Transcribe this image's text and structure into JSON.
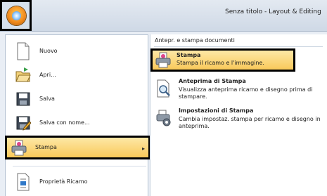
{
  "window": {
    "title": "Senza titolo - Layout & Editing"
  },
  "app_menu": {
    "items": [
      {
        "label": "Nuovo",
        "icon": "new-document-icon"
      },
      {
        "label": "Apri...",
        "icon": "open-folder-icon"
      },
      {
        "label": "Salva",
        "icon": "save-icon"
      },
      {
        "label": "Salva con nome...",
        "icon": "save-as-icon"
      },
      {
        "label": "Stampa",
        "icon": "print-icon",
        "highlighted": true
      },
      {
        "label": "Proprietà Ricamo",
        "icon": "properties-icon"
      }
    ]
  },
  "submenu": {
    "header": "Antepr. e stampa documenti",
    "items": [
      {
        "title": "Stampa",
        "desc": "Stampa il ricamo e l'immagine.",
        "icon": "print-icon",
        "highlighted": true
      },
      {
        "title": "Anteprima di Stampa",
        "desc": "Visualizza anteprima ricamo e disegno prima di stampare.",
        "icon": "print-preview-icon"
      },
      {
        "title": "Impostazioni di Stampa",
        "desc": "Cambia impostaz. stampa per ricamo e disegno in anteprima.",
        "icon": "print-settings-icon"
      }
    ]
  },
  "colors": {
    "highlight": "#f9c95a",
    "menu_bg": "#e9eef5"
  }
}
